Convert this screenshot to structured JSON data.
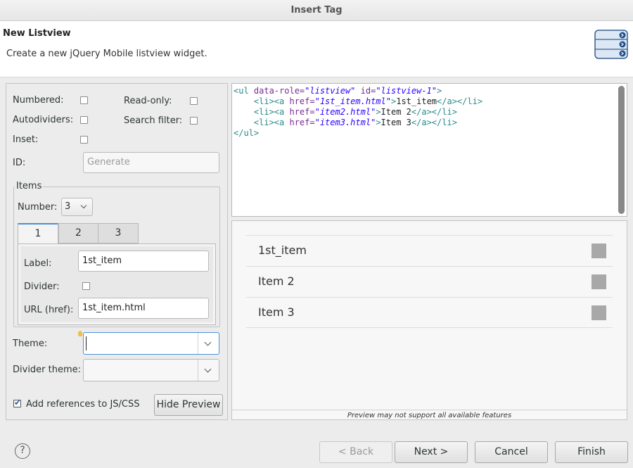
{
  "window": {
    "title": "Insert Tag"
  },
  "banner": {
    "title": "New Listview",
    "description": "Create a new jQuery Mobile listview widget.",
    "icon": "listview-widget-icon"
  },
  "form": {
    "numbered_label": "Numbered:",
    "numbered_checked": false,
    "readonly_label": "Read-only:",
    "readonly_checked": false,
    "autodividers_label": "Autodividers:",
    "autodividers_checked": false,
    "search_filter_label": "Search filter:",
    "search_filter_checked": false,
    "inset_label": "Inset:",
    "inset_checked": false,
    "id_label": "ID:",
    "id_placeholder": "Generate",
    "items_group_title": "Items",
    "number_label": "Number:",
    "number_value": "3",
    "tabs": [
      {
        "label": "1"
      },
      {
        "label": "2"
      },
      {
        "label": "3"
      }
    ],
    "active_tab": "1",
    "item": {
      "label_label": "Label:",
      "label_value": "1st_item",
      "divider_label": "Divider:",
      "divider_checked": false,
      "url_label": "URL (href):",
      "url_value": "1st_item.html"
    },
    "theme_label": "Theme:",
    "theme_value": "",
    "divider_theme_label": "Divider theme:",
    "divider_theme_value": "",
    "add_refs_label": "Add references to JS/CSS",
    "add_refs_checked": true,
    "hide_preview_label": "Hide Preview"
  },
  "code": {
    "ul_open_1": "<ul ",
    "ul_attr_role": "data-role=",
    "ul_val_role": "\"listview\"",
    "ul_attr_id": " id=",
    "ul_val_id": "\"listview-1\"",
    "ul_open_end": ">",
    "li_open": "<li><a ",
    "href_attr": "href=",
    "href_val_1": "\"1st_item.html\"",
    "href_val_2": "\"item2.html\"",
    "href_val_3": "\"item3.html\"",
    "gt": ">",
    "text_1": "1st_item",
    "text_2": "Item 2",
    "text_3": "Item 3",
    "li_close": "</a></li>",
    "ul_close": "</ul>"
  },
  "preview": {
    "items": [
      {
        "label": "1st_item"
      },
      {
        "label": "Item 2"
      },
      {
        "label": "Item 3"
      }
    ],
    "note": "Preview may not support all available features"
  },
  "footer": {
    "back_label": "< Back",
    "next_label": "Next >",
    "cancel_label": "Cancel",
    "finish_label": "Finish",
    "help_glyph": "?"
  }
}
